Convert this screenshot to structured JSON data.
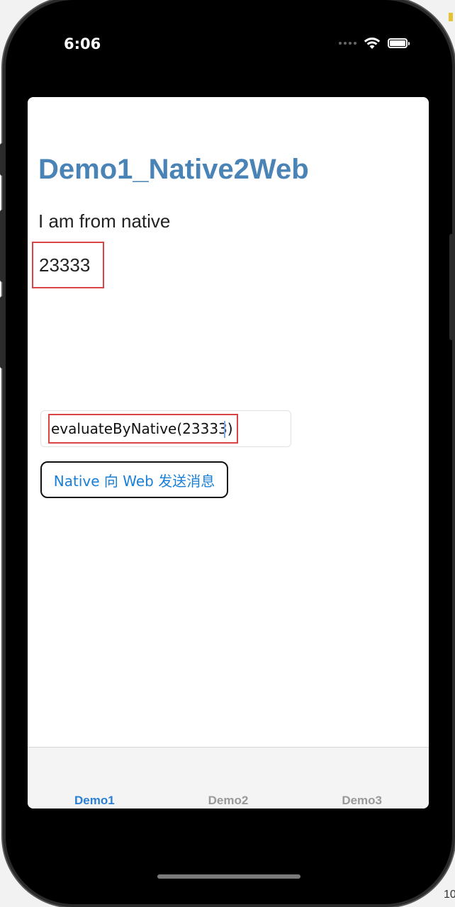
{
  "status_bar": {
    "time": "6:06"
  },
  "page": {
    "title": "Demo1_Native2Web",
    "from_native_text": "I am from native",
    "received_value": "23333"
  },
  "input": {
    "value": "evaluateByNative(23333)"
  },
  "send_button": {
    "label": "Native 向 Web 发送消息"
  },
  "tab_bar": {
    "tabs": [
      {
        "label": "Demo1",
        "active": true
      },
      {
        "label": "Demo2",
        "active": false
      },
      {
        "label": "Demo3",
        "active": false
      }
    ]
  },
  "corner_text": "10",
  "colors": {
    "title": "#4a83b5",
    "accent": "#2a7fd4",
    "highlight_border": "#d94444"
  }
}
